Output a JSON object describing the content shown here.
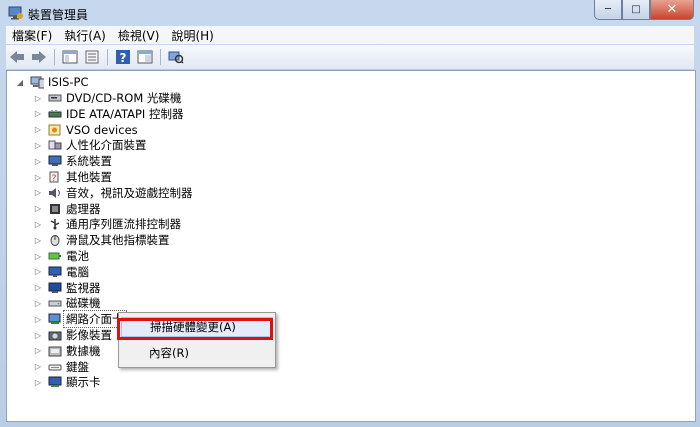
{
  "window": {
    "title": "裝置管理員",
    "controls": {
      "minimize": "─",
      "maximize": "□",
      "close": "✕"
    }
  },
  "menu": [
    "檔案(F)",
    "執行(A)",
    "檢視(V)",
    "說明(H)"
  ],
  "tree": {
    "root": "ISIS-PC",
    "items": [
      {
        "label": "DVD/CD-ROM 光碟機",
        "icon": "dvd-drive-icon"
      },
      {
        "label": "IDE ATA/ATAPI 控制器",
        "icon": "ide-controller-icon"
      },
      {
        "label": "VSO devices",
        "icon": "vso-device-icon"
      },
      {
        "label": "人性化介面裝置",
        "icon": "hid-icon"
      },
      {
        "label": "系統裝置",
        "icon": "system-device-icon"
      },
      {
        "label": "其他裝置",
        "icon": "other-device-icon"
      },
      {
        "label": "音效，視訊及遊戲控制器",
        "icon": "sound-icon"
      },
      {
        "label": "處理器",
        "icon": "processor-icon"
      },
      {
        "label": "通用序列匯流排控制器",
        "icon": "usb-icon"
      },
      {
        "label": "滑鼠及其他指標裝置",
        "icon": "mouse-icon"
      },
      {
        "label": "電池",
        "icon": "battery-icon"
      },
      {
        "label": "電腦",
        "icon": "computer-icon"
      },
      {
        "label": "監視器",
        "icon": "monitor-icon"
      },
      {
        "label": "磁碟機",
        "icon": "disk-drive-icon"
      },
      {
        "label": "網路介面卡",
        "icon": "network-adapter-icon"
      },
      {
        "label": "影像裝置",
        "icon": "imaging-device-icon"
      },
      {
        "label": "數據機",
        "icon": "modem-icon"
      },
      {
        "label": "鍵盤",
        "icon": "keyboard-icon"
      },
      {
        "label": "顯示卡",
        "icon": "display-adapter-icon"
      }
    ]
  },
  "context_menu": {
    "scan": "掃描硬體變更(A)",
    "properties": "內容(R)"
  },
  "colors": {
    "highlight_box": "#e01010",
    "menu_highlight": "#e3ecf8"
  }
}
